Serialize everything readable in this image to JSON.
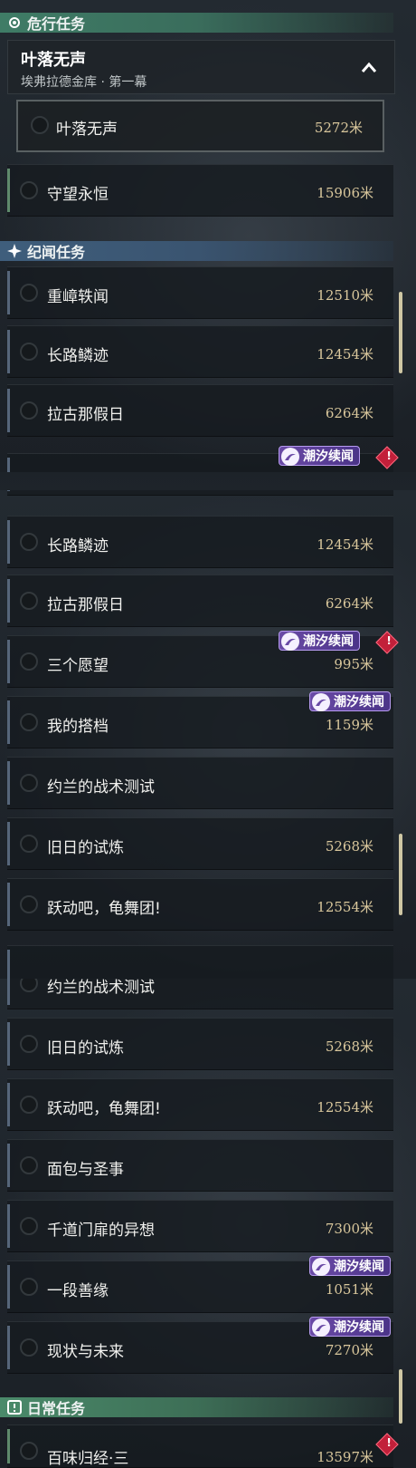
{
  "sections": {
    "danger": {
      "label": "危行任务"
    },
    "story": {
      "label": "纪闻任务"
    },
    "daily": {
      "label": "日常任务"
    }
  },
  "group": {
    "title": "叶落无声",
    "subtitle": "埃弗拉德金库 · 第一幕"
  },
  "badge_label": "潮汐续闻",
  "warn_symbol": "!",
  "colors": {
    "danger_header": "#3f7c66",
    "story_header": "#3f5e7c",
    "distance": "#d9c79c",
    "badge": "#6a4aa6",
    "warn": "#c2203a"
  },
  "seg1": {
    "danger_rows": [
      {
        "name": "叶落无声",
        "distance": "5272米"
      },
      {
        "name": "守望永恒",
        "distance": "15906米"
      }
    ],
    "story_rows": [
      {
        "name": "重嶂轶闻",
        "distance": "12510米"
      },
      {
        "name": "长路鳞迹",
        "distance": "12454米"
      },
      {
        "name": "拉古那假日",
        "distance": "6264米"
      }
    ]
  },
  "seg2": {
    "rows": [
      {
        "name": "长路鳞迹",
        "distance": "12454米"
      },
      {
        "name": "拉古那假日",
        "distance": "6264米"
      },
      {
        "name": "三个愿望",
        "distance": "995米"
      },
      {
        "name": "我的搭档",
        "distance": "1159米"
      },
      {
        "name": "约兰的战术测试",
        "distance": ""
      },
      {
        "name": "旧日的试炼",
        "distance": "5268米"
      },
      {
        "name": "跃动吧，龟舞团!",
        "distance": "12554米"
      }
    ]
  },
  "seg3": {
    "rows": [
      {
        "name": "约兰的战术测试",
        "distance": ""
      },
      {
        "name": "旧日的试炼",
        "distance": "5268米"
      },
      {
        "name": "跃动吧，龟舞团!",
        "distance": "12554米"
      },
      {
        "name": "面包与圣事",
        "distance": ""
      },
      {
        "name": "千道门扉的异想",
        "distance": "7300米"
      },
      {
        "name": "一段善缘",
        "distance": "1051米"
      },
      {
        "name": "现状与未来",
        "distance": "7270米"
      }
    ],
    "daily_partial": {
      "name": "百味归经·三",
      "distance": "13597米"
    }
  }
}
